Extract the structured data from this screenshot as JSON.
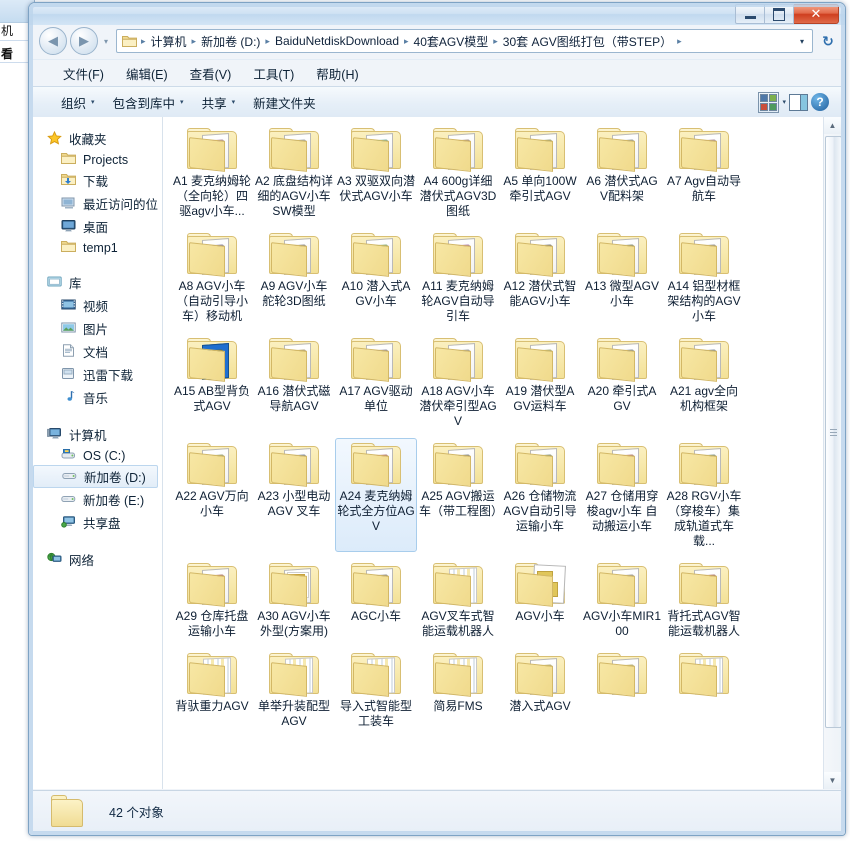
{
  "background_window": {
    "text_top": "机",
    "text_bottom": "看"
  },
  "window": {
    "minimize_label": "最小化",
    "maximize_label": "最大化",
    "close_label": "✕"
  },
  "address_bar": {
    "back_label": "◀",
    "forward_label": "▶",
    "history_label": "▾",
    "dropdown_label": "▾",
    "refresh_label": "↻",
    "breadcrumbs": [
      "计算机",
      "新加卷 (D:)",
      "BaiduNetdiskDownload",
      "40套AGV模型",
      "30套 AGV图纸打包（带STEP）"
    ],
    "separator": "▸"
  },
  "menu_bar": {
    "items": [
      "文件(F)",
      "编辑(E)",
      "查看(V)",
      "工具(T)",
      "帮助(H)"
    ]
  },
  "toolbar": {
    "organize": "组织",
    "include_in_library": "包含到库中",
    "share": "共享",
    "new_folder": "新建文件夹",
    "caret": "▾",
    "help_label": "?"
  },
  "nav_pane": {
    "groups": [
      {
        "header": "收藏夹",
        "header_icon": "star-icon",
        "items": [
          {
            "label": "Projects",
            "icon": "folder-icon",
            "selected": false
          },
          {
            "label": "下载",
            "icon": "download-folder-icon",
            "selected": false
          },
          {
            "label": "最近访问的位",
            "icon": "recent-places-icon",
            "selected": false
          },
          {
            "label": "桌面",
            "icon": "desktop-icon",
            "selected": false
          },
          {
            "label": "temp1",
            "icon": "folder-icon",
            "selected": false
          }
        ]
      },
      {
        "header": "库",
        "header_icon": "library-icon",
        "items": [
          {
            "label": "视频",
            "icon": "video-icon",
            "selected": false
          },
          {
            "label": "图片",
            "icon": "picture-icon",
            "selected": false
          },
          {
            "label": "文档",
            "icon": "document-icon",
            "selected": false
          },
          {
            "label": "迅雷下载",
            "icon": "thunder-download-icon",
            "selected": false
          },
          {
            "label": "音乐",
            "icon": "music-note-icon",
            "selected": false
          }
        ]
      },
      {
        "header": "计算机",
        "header_icon": "computer-icon",
        "items": [
          {
            "label": "OS (C:)",
            "icon": "system-drive-icon",
            "selected": false
          },
          {
            "label": "新加卷 (D:)",
            "icon": "drive-icon",
            "selected": true
          },
          {
            "label": "新加卷 (E:)",
            "icon": "drive-icon",
            "selected": false
          },
          {
            "label": "共享盘",
            "icon": "network-drive-icon",
            "selected": false
          }
        ]
      },
      {
        "header": "网络",
        "header_icon": "network-icon",
        "items": []
      }
    ]
  },
  "files": [
    {
      "name": "A1 麦克纳姆轮（全向轮）四驱agv小车...",
      "thumb": "#c96fa8",
      "style": "paper",
      "selected": false
    },
    {
      "name": "A2 底盘结构详细的AGV小车SW模型",
      "thumb": "#9fb0c0",
      "style": "paper",
      "selected": false
    },
    {
      "name": "A3 双驱双向潜伏式AGV小车",
      "thumb": "#2cc0a8",
      "style": "paper",
      "selected": false
    },
    {
      "name": "A4 600g详细潜伏式AGV3D图纸",
      "thumb": "#b07a5c",
      "style": "paper",
      "selected": false
    },
    {
      "name": "A5 单向100W牵引式AGV",
      "thumb": "#8a9a3a",
      "style": "paper",
      "selected": false
    },
    {
      "name": "A6 潜伏式AGV配料架",
      "thumb": "#7a8fa0",
      "style": "paper",
      "selected": false
    },
    {
      "name": "A7  Agv自动导航车",
      "thumb": "#b86f9c",
      "style": "paper",
      "selected": false
    },
    {
      "name": "A8 AGV小车（自动引导小车）移动机",
      "thumb": "#5a4fa8",
      "style": "paper",
      "selected": false
    },
    {
      "name": "A9 AGV小车舵轮3D图纸",
      "thumb": "#6d6f74",
      "style": "paper",
      "selected": false
    },
    {
      "name": "A10  潜入式AGV小车",
      "thumb": "#5fbf3f",
      "style": "paper",
      "selected": false
    },
    {
      "name": "A11 麦克纳姆轮AGV自动导引车",
      "thumb": "#c03fb0",
      "style": "paper",
      "selected": false
    },
    {
      "name": "A12 潜伏式智能AGV小车",
      "thumb": "#3a3a3a",
      "style": "paper",
      "selected": false
    },
    {
      "name": "A13  微型AGV小车",
      "thumb": "#4f6b42",
      "style": "paper",
      "selected": false
    },
    {
      "name": "A14 铝型材框架结构的AGV小车",
      "thumb": "#7f7f7f",
      "style": "paper",
      "selected": false
    },
    {
      "name": "A15 AB型背负式AGV",
      "thumb": "#5f6b3f",
      "style": "blue",
      "selected": false
    },
    {
      "name": "A16 潜伏式磁导航AGV",
      "thumb": "#c9a24a",
      "style": "paper",
      "selected": false
    },
    {
      "name": "A17 AGV驱动单位",
      "thumb": "#7b6fa8",
      "style": "paper",
      "selected": false
    },
    {
      "name": "A18 AGV小车潜伏牵引型AGV",
      "thumb": "#8f98a4",
      "style": "paper",
      "selected": false
    },
    {
      "name": "A19 潜伏型AGV运料车",
      "thumb": "#b0c44a",
      "style": "paper",
      "selected": false
    },
    {
      "name": "A20  牵引式AGV",
      "thumb": "#4a6fa8",
      "style": "paper",
      "selected": false
    },
    {
      "name": "A21 agv全向机构框架",
      "thumb": "#4a6fa8",
      "style": "paper",
      "selected": false
    },
    {
      "name": "A22 AGV万向小车",
      "thumb": "#8aa63f",
      "style": "paper",
      "selected": false
    },
    {
      "name": "A23 小型电动AGV 叉车",
      "thumb": "#3f5fa8",
      "style": "paper",
      "selected": false
    },
    {
      "name": "A24  麦克纳姆轮式全方位AGV",
      "thumb": "#cc2f2f",
      "style": "paper",
      "selected": true
    },
    {
      "name": "A25 AGV搬运车（带工程图）",
      "thumb": "#4a5560",
      "style": "paper",
      "selected": false
    },
    {
      "name": "A26 仓储物流AGV自动引导运输小车",
      "thumb": "#5a7f3f",
      "style": "paper",
      "selected": false
    },
    {
      "name": "A27  仓储用穿梭agv小车 自动搬运小车",
      "thumb": "#d04a3a",
      "style": "paper",
      "selected": false
    },
    {
      "name": "A28  RGV小车（穿梭车）集成轨道式车载...",
      "thumb": "#4a7f5f",
      "style": "paper",
      "selected": false
    },
    {
      "name": "A29 仓库托盘运输小车",
      "thumb": "#c23a2a",
      "style": "paper",
      "selected": false
    },
    {
      "name": "A30 AGV小车外型(方案用)",
      "thumb": "#c8a23a",
      "style": "grid",
      "selected": false
    },
    {
      "name": "AGC小车",
      "thumb": "#6b6b6b",
      "style": "paper",
      "selected": false
    },
    {
      "name": "AGV叉车式智能运载机器人",
      "thumb": "#a8b4c0",
      "style": "stack",
      "selected": false
    },
    {
      "name": "AGV小车",
      "thumb": "#e0c65a",
      "style": "cube",
      "selected": false
    },
    {
      "name": "AGV小车MIR100",
      "thumb": "#8a8a8a",
      "style": "paper",
      "selected": false
    },
    {
      "name": "背托式AGV智能运载机器人",
      "thumb": "#c0392b",
      "style": "paper",
      "selected": false
    },
    {
      "name": "背驮重力AGV",
      "thumb": "#a8b4c0",
      "style": "stack",
      "selected": false
    },
    {
      "name": "单举升装配型AGV",
      "thumb": "#a8b4c0",
      "style": "stack",
      "selected": false
    },
    {
      "name": "导入式智能型工装车",
      "thumb": "#a8b4c0",
      "style": "stack",
      "selected": false
    },
    {
      "name": "简易FMS",
      "thumb": "#a8b4c0",
      "style": "stack",
      "selected": false
    },
    {
      "name": "潜入式AGV",
      "thumb": "#d4c23a",
      "style": "paper",
      "selected": false
    },
    {
      "name": "",
      "thumb": "#d4c23a",
      "style": "paper",
      "selected": false
    },
    {
      "name": "",
      "thumb": "#a8b4c0",
      "style": "stack",
      "selected": false
    }
  ],
  "scrollbar": {
    "up_label": "▲",
    "down_label": "▼"
  },
  "status_bar": {
    "text": "42 个对象"
  }
}
